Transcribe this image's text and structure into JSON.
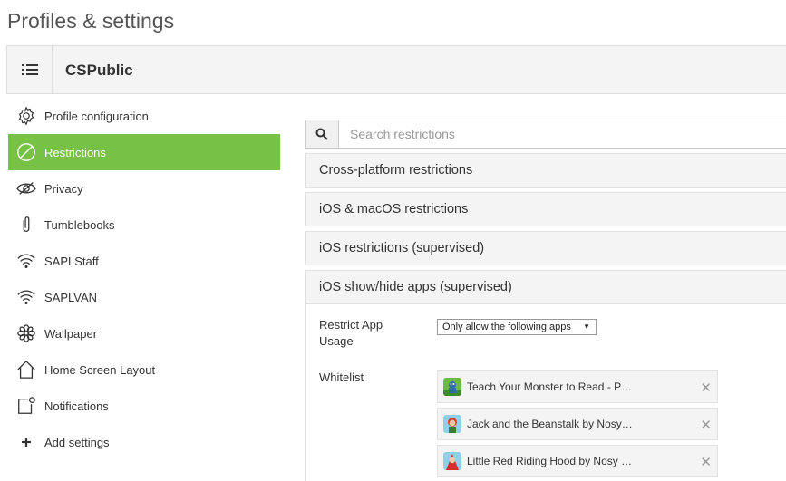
{
  "page": {
    "title": "Profiles & settings"
  },
  "header": {
    "title": "CSPublic",
    "menu_icon": "list-icon"
  },
  "sidebar": {
    "items": [
      {
        "label": "Profile configuration",
        "icon": "gear-icon"
      },
      {
        "label": "Restrictions",
        "icon": "prohibit-icon",
        "active": true
      },
      {
        "label": "Privacy",
        "icon": "eye-icon"
      },
      {
        "label": "Tumblebooks",
        "icon": "paperclip-icon"
      },
      {
        "label": "SAPLStaff",
        "icon": "wifi-icon"
      },
      {
        "label": "SAPLVAN",
        "icon": "wifi-icon"
      },
      {
        "label": "Wallpaper",
        "icon": "flower-icon"
      },
      {
        "label": "Home Screen Layout",
        "icon": "home-icon"
      },
      {
        "label": "Notifications",
        "icon": "notification-icon"
      },
      {
        "label": "Add settings",
        "icon": "plus-icon"
      }
    ],
    "active_color": "#77c147"
  },
  "search": {
    "placeholder": "Search restrictions",
    "icon": "search-icon"
  },
  "panels": [
    {
      "label": "Cross-platform restrictions"
    },
    {
      "label": "iOS & macOS restrictions"
    },
    {
      "label": "iOS restrictions (supervised)"
    },
    {
      "label": "iOS show/hide apps (supervised)"
    }
  ],
  "show_hide": {
    "restrict_label": "Restrict App Usage",
    "restrict_value": "Only allow the following apps",
    "whitelist_label": "Whitelist",
    "apps": [
      {
        "name": "Teach Your Monster to Read - P…"
      },
      {
        "name": "Jack and the Beanstalk by Nosy…"
      },
      {
        "name": "Little Red Riding Hood by Nosy …"
      }
    ],
    "remove_icon": "close-icon"
  }
}
